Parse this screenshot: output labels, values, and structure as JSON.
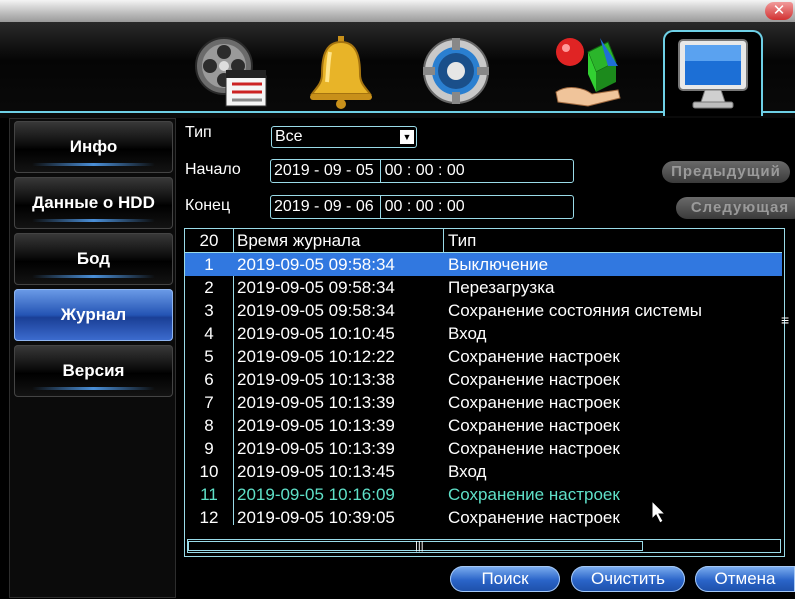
{
  "window": {
    "close_glyph": "✕"
  },
  "tabs": [
    {
      "icon": "film-reel-icon"
    },
    {
      "icon": "bell-icon"
    },
    {
      "icon": "gear-icon"
    },
    {
      "icon": "shapes-icon"
    },
    {
      "icon": "monitor-icon",
      "active": true
    }
  ],
  "sidebar": {
    "items": [
      {
        "label": "Инфо"
      },
      {
        "label": "Данные о HDD"
      },
      {
        "label": "Бод"
      },
      {
        "label": "Журнал",
        "active": true
      },
      {
        "label": "Версия"
      }
    ]
  },
  "filters": {
    "type_label": "Тип",
    "type_value": "Все",
    "start_label": "Начало",
    "start_date": "2019 - 09 - 05",
    "start_time": "00 : 00 : 00",
    "end_label": "Конец",
    "end_date": "2019 - 09 - 06",
    "end_time": "00 : 00 : 00",
    "prev_label": "Предыдущий",
    "next_label": "Следующая"
  },
  "log": {
    "headers": {
      "count": "20",
      "time": "Время журнала",
      "type": "Тип"
    },
    "rows": [
      {
        "n": "1",
        "time": "2019-09-05 09:58:34",
        "type": "Выключение"
      },
      {
        "n": "2",
        "time": "2019-09-05 09:58:34",
        "type": "Перезагрузка"
      },
      {
        "n": "3",
        "time": "2019-09-05 09:58:34",
        "type": "Сохранение состояния системы"
      },
      {
        "n": "4",
        "time": "2019-09-05 10:10:45",
        "type": "Вход"
      },
      {
        "n": "5",
        "time": "2019-09-05 10:12:22",
        "type": "Сохранение настроек"
      },
      {
        "n": "6",
        "time": "2019-09-05 10:13:38",
        "type": "Сохранение настроек"
      },
      {
        "n": "7",
        "time": "2019-09-05 10:13:39",
        "type": "Сохранение настроек"
      },
      {
        "n": "8",
        "time": "2019-09-05 10:13:39",
        "type": "Сохранение настроек"
      },
      {
        "n": "9",
        "time": "2019-09-05 10:13:39",
        "type": "Сохранение настроек"
      },
      {
        "n": "10",
        "time": "2019-09-05 10:13:45",
        "type": "Вход"
      },
      {
        "n": "11",
        "time": "2019-09-05 10:16:09",
        "type": "Сохранение настроек"
      },
      {
        "n": "12",
        "time": "2019-09-05 10:39:05",
        "type": "Сохранение настроек"
      }
    ]
  },
  "buttons": {
    "search": "Поиск",
    "clear": "Очистить",
    "cancel": "Отмена"
  },
  "colors": {
    "accent": "#6ed0e6",
    "selected": "#3178e0",
    "teal_text": "#5fe0c8"
  }
}
